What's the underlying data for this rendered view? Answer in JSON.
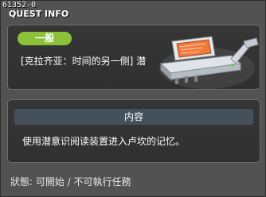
{
  "quest_id": "61352-0",
  "window": {
    "title": "QUEST INFO"
  },
  "quest": {
    "category_badge": "一般",
    "name": "[克拉齐亚：时间的另一侧] 潜",
    "illustration_icon": "memory-reading-device-icon"
  },
  "content": {
    "header": "内容",
    "text": "使用潜意识阅读装置进入卢坎的记忆。"
  },
  "status": {
    "text": "狀態: 可開始 / 不可執行任務"
  },
  "colors": {
    "badge": "#8cc23a",
    "panel": "#333333",
    "content_header": "#44505a",
    "device_screen": "#f07a3c"
  }
}
